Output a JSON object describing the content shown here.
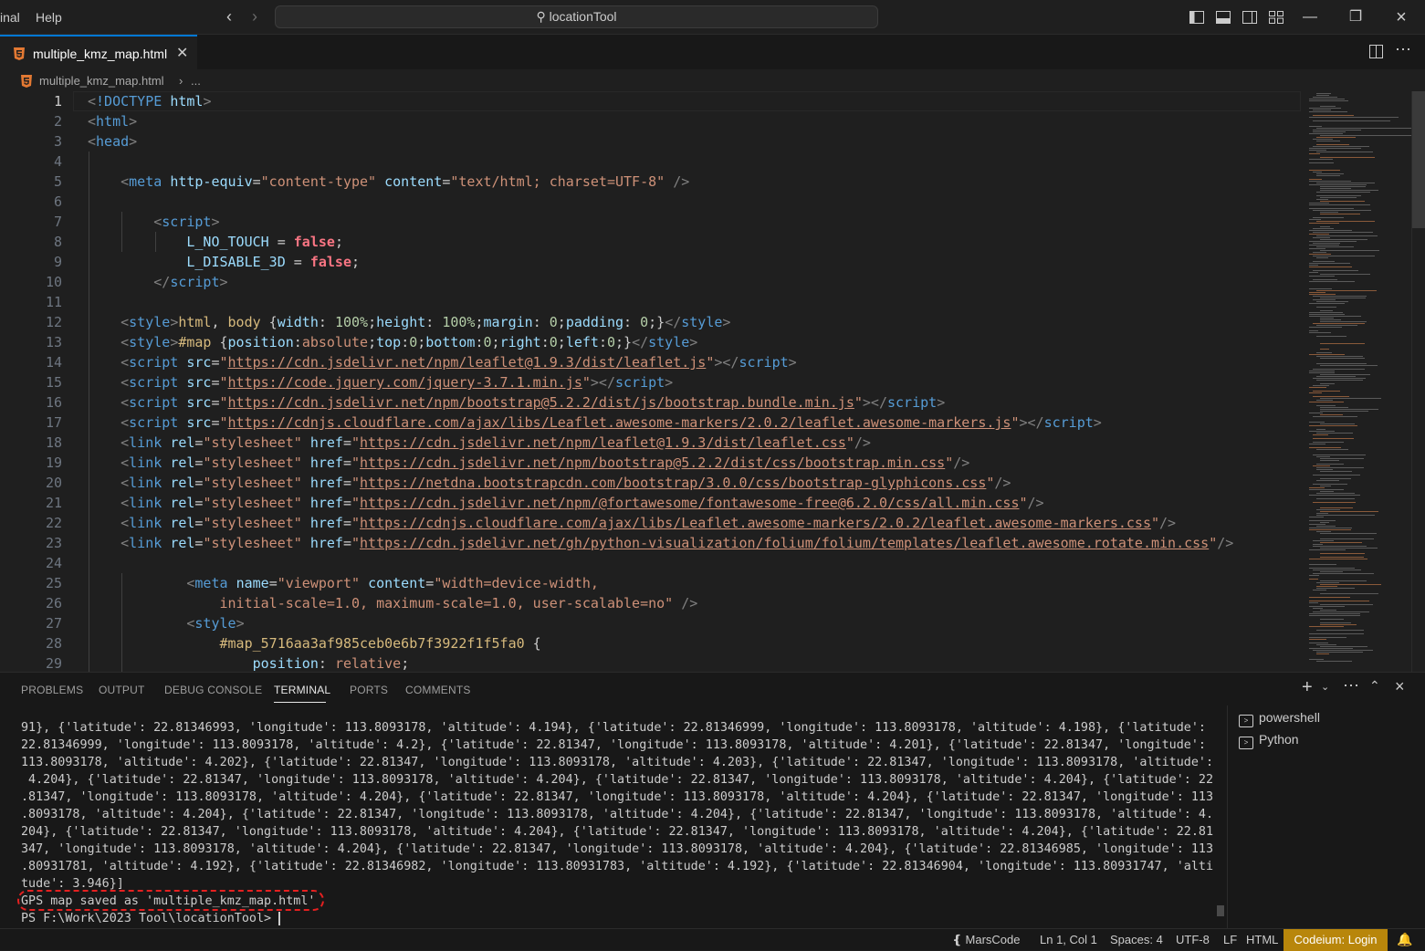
{
  "titlebar": {
    "menu": [
      "inal",
      "Help"
    ],
    "search": "locationTool",
    "back_icon": "chevron-left",
    "forward_icon": "chevron-right",
    "window_controls": [
      "minimize",
      "restore",
      "close"
    ]
  },
  "tab": {
    "label": "multiple_kmz_map.html",
    "close": "✕"
  },
  "breadcrumb": {
    "file": "multiple_kmz_map.html",
    "separator": "›",
    "more": "..."
  },
  "editor": {
    "line_numbers": [
      "1",
      "2",
      "3",
      "4",
      "5",
      "6",
      "7",
      "8",
      "9",
      "10",
      "11",
      "12",
      "13",
      "14",
      "15",
      "16",
      "17",
      "18",
      "19",
      "20",
      "21",
      "22",
      "23",
      "24",
      "25",
      "26",
      "27",
      "28",
      "29"
    ]
  },
  "panel": {
    "tabs": [
      "PROBLEMS",
      "OUTPUT",
      "DEBUG CONSOLE",
      "TERMINAL",
      "PORTS",
      "COMMENTS"
    ],
    "active_tab": "TERMINAL",
    "terminals": [
      "powershell",
      "Python"
    ],
    "lines": [
      "91}, {'latitude': 22.81346993, 'longitude': 113.8093178, 'altitude': 4.194}, {'latitude': 22.81346999, 'longitude': 113.8093178, 'altitude': 4.198}, {'latitude':",
      "22.81346999, 'longitude': 113.8093178, 'altitude': 4.2}, {'latitude': 22.81347, 'longitude': 113.8093178, 'altitude': 4.201}, {'latitude': 22.81347, 'longitude':",
      "113.8093178, 'altitude': 4.202}, {'latitude': 22.81347, 'longitude': 113.8093178, 'altitude': 4.203}, {'latitude': 22.81347, 'longitude': 113.8093178, 'altitude':",
      " 4.204}, {'latitude': 22.81347, 'longitude': 113.8093178, 'altitude': 4.204}, {'latitude': 22.81347, 'longitude': 113.8093178, 'altitude': 4.204}, {'latitude': 22",
      ".81347, 'longitude': 113.8093178, 'altitude': 4.204}, {'latitude': 22.81347, 'longitude': 113.8093178, 'altitude': 4.204}, {'latitude': 22.81347, 'longitude': 113",
      ".8093178, 'altitude': 4.204}, {'latitude': 22.81347, 'longitude': 113.8093178, 'altitude': 4.204}, {'latitude': 22.81347, 'longitude': 113.8093178, 'altitude': 4.",
      "204}, {'latitude': 22.81347, 'longitude': 113.8093178, 'altitude': 4.204}, {'latitude': 22.81347, 'longitude': 113.8093178, 'altitude': 4.204}, {'latitude': 22.81",
      "347, 'longitude': 113.8093178, 'altitude': 4.204}, {'latitude': 22.81347, 'longitude': 113.8093178, 'altitude': 4.204}, {'latitude': 22.81346985, 'longitude': 113",
      ".80931781, 'altitude': 4.192}, {'latitude': 22.81346982, 'longitude': 113.80931783, 'altitude': 4.192}, {'latitude': 22.81346904, 'longitude': 113.80931747, 'alti",
      "tude': 3.946}]",
      "GPS map saved as 'multiple_kmz_map.html'",
      "PS F:\\Work\\2023 Tool\\locationTool> "
    ]
  },
  "statusbar": {
    "marscode": "MarsCode",
    "position": "Ln 1, Col 1",
    "spaces": "Spaces: 4",
    "encoding": "UTF-8",
    "eol": "LF",
    "language": "HTML",
    "codeium": "Codeium: Login"
  },
  "colors": {
    "accent": "#0078d4",
    "codeium_bg": "#b8860b",
    "annotation": "#e52020"
  }
}
